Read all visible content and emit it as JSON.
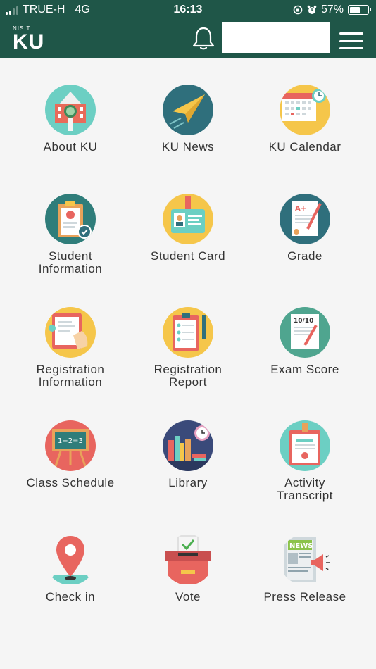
{
  "status_bar": {
    "carrier": "TRUE-H",
    "network": "4G",
    "time": "16:13",
    "battery": "57%",
    "battery_level": 0.57
  },
  "header": {
    "logo_top": "NISIT",
    "logo_main": "KU",
    "search_value": ""
  },
  "menu": [
    {
      "label": "About KU",
      "icon": "university-building-icon",
      "color": "#6ccfc3"
    },
    {
      "label": "KU News",
      "icon": "paper-plane-icon",
      "color": "#2f6f7c"
    },
    {
      "label": "KU Calendar",
      "icon": "calendar-icon",
      "color": "#f5c64a"
    },
    {
      "label": "Student\nInformation",
      "icon": "clipboard-profile-icon",
      "color": "#2f7d7a"
    },
    {
      "label": "Student Card",
      "icon": "id-card-icon",
      "color": "#f5c64a"
    },
    {
      "label": "Grade",
      "icon": "grade-paper-icon",
      "color": "#2f6f7c"
    },
    {
      "label": "Registration\nInformation",
      "icon": "tablet-hand-icon",
      "color": "#f5c64a"
    },
    {
      "label": "Registration\nReport",
      "icon": "checklist-clipboard-icon",
      "color": "#f5c64a"
    },
    {
      "label": "Exam Score",
      "icon": "exam-paper-icon",
      "color": "#4fa58f"
    },
    {
      "label": "Class Schedule",
      "icon": "chalkboard-icon",
      "color": "#e8655f"
    },
    {
      "label": "Library",
      "icon": "books-clock-icon",
      "color": "#3a4a7a"
    },
    {
      "label": "Activity\nTranscript",
      "icon": "certificate-icon",
      "color": "#6ccfc3"
    },
    {
      "label": "Check in",
      "icon": "map-pin-icon",
      "color": "#f5f5f5"
    },
    {
      "label": "Vote",
      "icon": "ballot-box-icon",
      "color": "#f5f5f5"
    },
    {
      "label": "Press Release",
      "icon": "newspaper-megaphone-icon",
      "color": "#f5f5f5"
    }
  ]
}
